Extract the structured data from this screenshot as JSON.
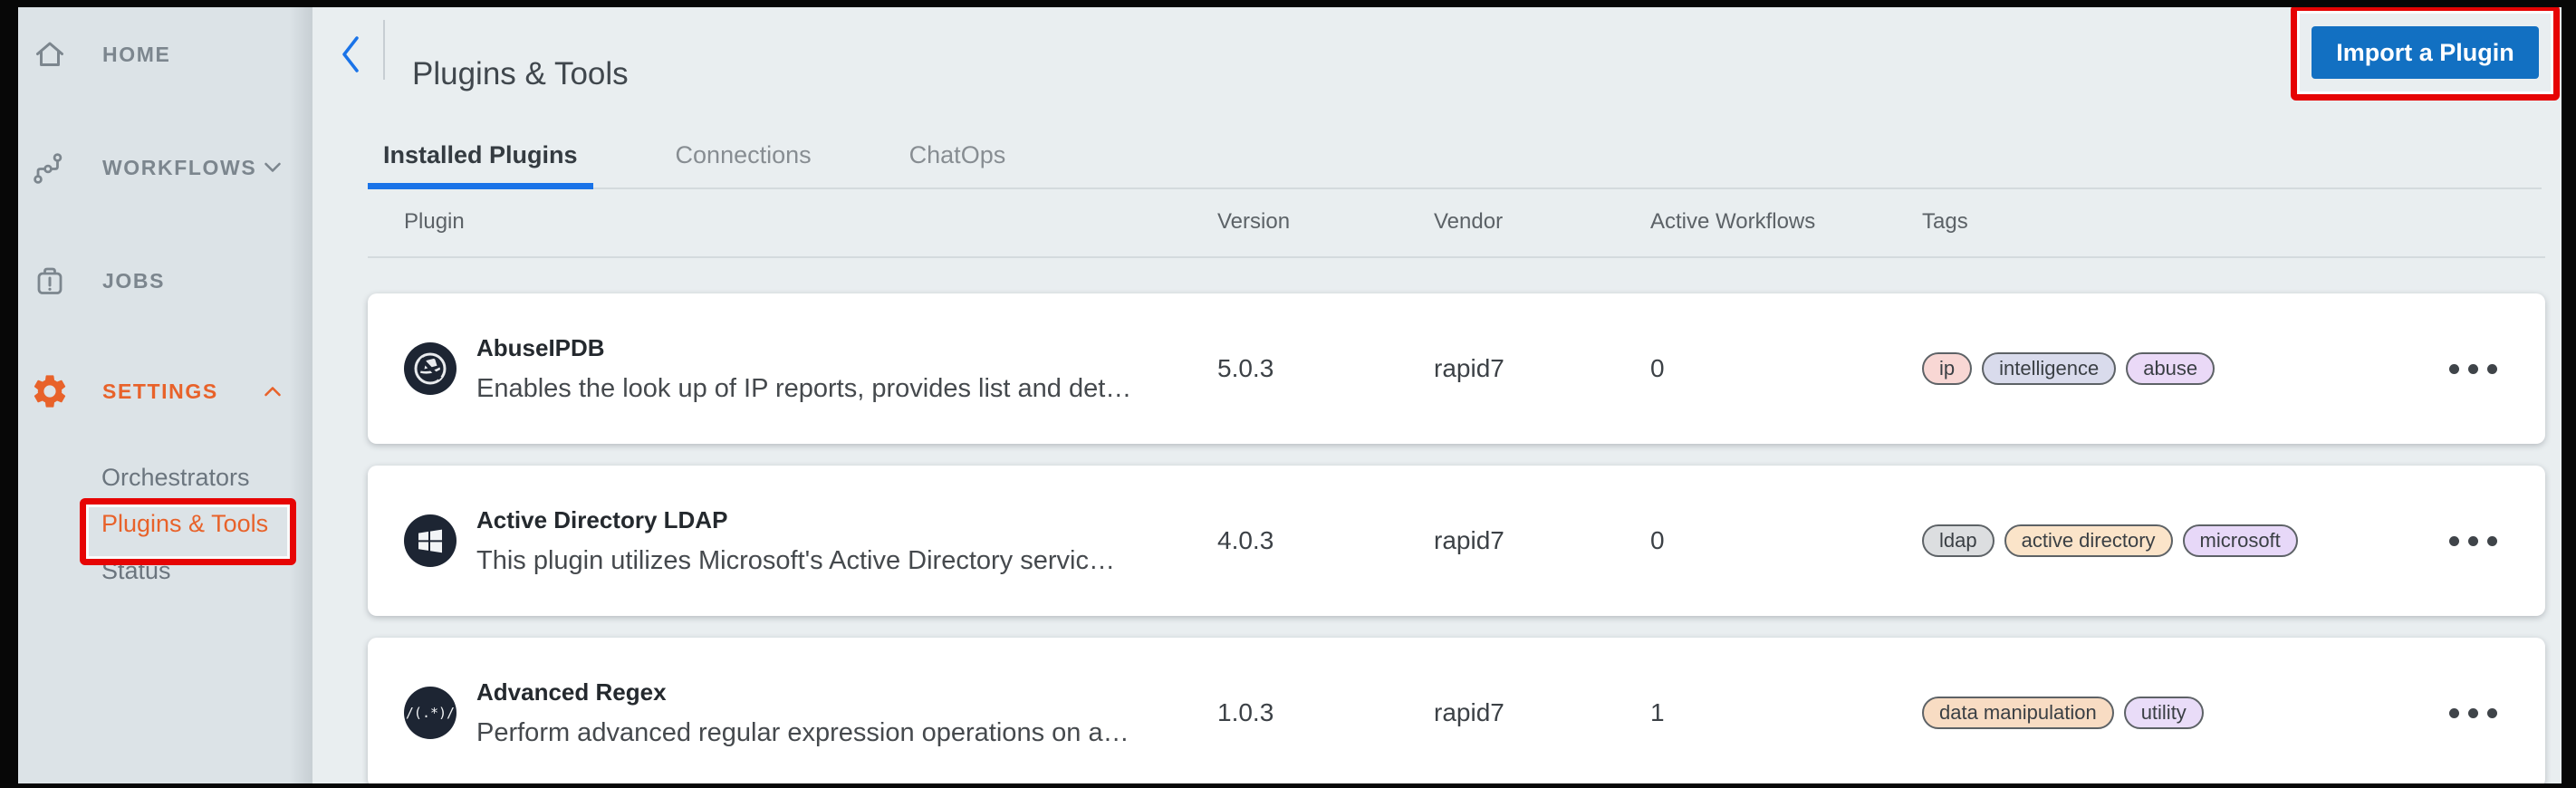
{
  "sidebar": {
    "items": [
      {
        "label": "HOME",
        "icon": "home-icon"
      },
      {
        "label": "WORKFLOWS",
        "icon": "workflows-icon",
        "chevron": "down"
      },
      {
        "label": "JOBS",
        "icon": "jobs-icon"
      },
      {
        "label": "SETTINGS",
        "icon": "settings-gear-icon",
        "chevron": "up",
        "active": true
      }
    ],
    "subitems": [
      {
        "label": "Orchestrators",
        "active": false
      },
      {
        "label": "Plugins & Tools",
        "active": true,
        "annotated": true
      },
      {
        "label": "Status",
        "active": false
      }
    ]
  },
  "header": {
    "title": "Plugins & Tools",
    "back_icon": "back-chevron-icon",
    "import_button_label": "Import a Plugin"
  },
  "tabs": [
    {
      "label": "Installed Plugins",
      "active": true
    },
    {
      "label": "Connections",
      "active": false
    },
    {
      "label": "ChatOps",
      "active": false
    }
  ],
  "table": {
    "columns": [
      "Plugin",
      "Version",
      "Vendor",
      "Active Workflows",
      "Tags"
    ],
    "rows": [
      {
        "name": "AbuseIPDB",
        "description": "Enables the look up of IP reports, provides list and det…",
        "version": "5.0.3",
        "vendor": "rapid7",
        "active_workflows": "0",
        "icon": "abuseipdb-logo",
        "tags": [
          {
            "label": "ip",
            "bg": "#f8d7d4"
          },
          {
            "label": "intelligence",
            "bg": "#d9dbec"
          },
          {
            "label": "abuse",
            "bg": "#ead9f7"
          }
        ]
      },
      {
        "name": "Active Directory LDAP",
        "description": "This plugin utilizes Microsoft's Active Directory servic…",
        "version": "4.0.3",
        "vendor": "rapid7",
        "active_workflows": "0",
        "icon": "windows-logo",
        "tags": [
          {
            "label": "ldap",
            "bg": "#dcdee0"
          },
          {
            "label": "active directory",
            "bg": "#fbe4c9"
          },
          {
            "label": "microsoft",
            "bg": "#e7d8f8"
          }
        ]
      },
      {
        "name": "Advanced Regex",
        "description": "Perform advanced regular expression operations on a…",
        "version": "1.0.3",
        "vendor": "rapid7",
        "active_workflows": "1",
        "icon": "regex-logo",
        "icon_text": "/(.*)/",
        "tags": [
          {
            "label": "data manipulation",
            "bg": "#f8dcc3"
          },
          {
            "label": "utility",
            "bg": "#e9dcf8"
          }
        ]
      }
    ]
  },
  "colors": {
    "accent_blue": "#1a73e8",
    "button_blue": "#1270c2",
    "brand_orange": "#e8622a",
    "annotation_red": "#e60404"
  }
}
